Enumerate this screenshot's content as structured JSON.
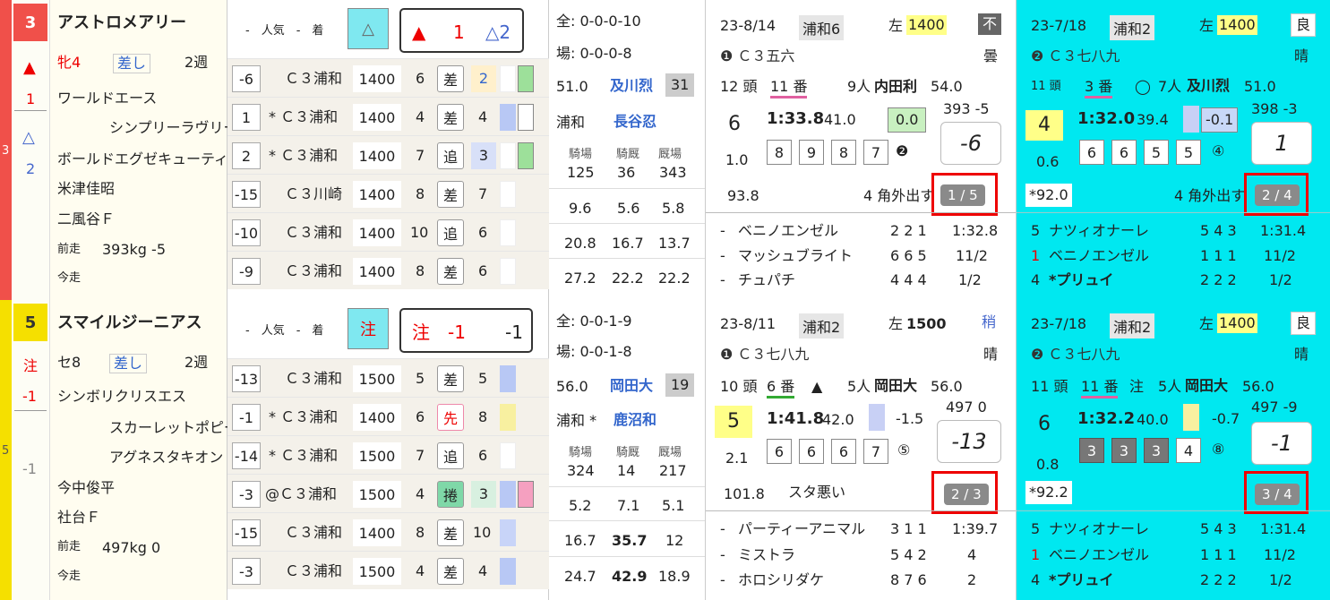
{
  "entries": [
    {
      "gate": "3",
      "gate_color": "#f0504a",
      "frame_num": "3",
      "mark_main": "▲",
      "mark_sub": "1",
      "mark_tri": "△",
      "mark_tri_num": "2",
      "name": "アストロメアリー",
      "sex_age": "牝4",
      "style": "差し",
      "interval": "2週",
      "sire": "ワールドエース",
      "dam": "シンプリーラヴリー",
      "damsire": "ボールドエグゼキューティブ",
      "jockey_trainer": "米津佳昭",
      "owner": "二風谷Ｆ",
      "prev_label": "前走",
      "weight": "393kg  -5",
      "now_label": "今走",
      "pop_label": "-　人気　-　着",
      "pop_mark": "△",
      "big_mark1": "▲",
      "big_mark1_num": "1",
      "big_mark2": "△2",
      "races": [
        {
          "diff": "-6",
          "cls": "Ｃ３浦和",
          "dist": "1400",
          "field": "6",
          "run": "差",
          "pos": "2"
        },
        {
          "diff": "1",
          "cls": "* Ｃ３浦和",
          "dist": "1400",
          "field": "4",
          "run": "差",
          "pos": "4"
        },
        {
          "diff": "2",
          "cls": "* Ｃ３浦和",
          "dist": "1400",
          "field": "7",
          "run": "追",
          "pos": "3"
        },
        {
          "diff": "-15",
          "cls": "Ｃ３川崎",
          "dist": "1400",
          "field": "8",
          "run": "差",
          "pos": "7"
        },
        {
          "diff": "-10",
          "cls": "Ｃ３浦和",
          "dist": "1400",
          "field": "10",
          "run": "追",
          "pos": "6"
        },
        {
          "diff": "-9",
          "cls": "Ｃ３浦和",
          "dist": "1400",
          "field": "8",
          "run": "差",
          "pos": "6"
        }
      ],
      "rec_all": "全: 0-0-0-10",
      "rec_course": "場: 0-0-0-8",
      "weight_carry": "51.0",
      "jockey": "及川烈",
      "jockey_num": "31",
      "trainer_loc": "浦和",
      "trainer": "長谷忍",
      "stat_h1": "騎場",
      "stat_h2": "騎厩",
      "stat_h3": "厩場",
      "stat_r1": [
        "125",
        "36",
        "343"
      ],
      "stat_r2": [
        "9.6",
        "5.6",
        "5.8"
      ],
      "stat_r3": [
        "20.8",
        "16.7",
        "13.7"
      ],
      "stat_r4": [
        "27.2",
        "22.2",
        "22.2"
      ],
      "p1": {
        "date": "23-8/14",
        "course": "浦和6",
        "dist_label": "左",
        "dist": "1400",
        "track": "不",
        "cls": "❶ Ｃ３五六",
        "weather": "曇",
        "heads": "12 頭",
        "no": "11 番",
        "mk": "",
        "pop": "9人",
        "jockey": "内田利",
        "wt": "54.0",
        "place": "6",
        "time": "1:33.8",
        "f3": "41.0",
        "odds": "1.0",
        "diff": "0.0",
        "bw": "393 -5",
        "corners": [
          "8",
          "9",
          "8",
          "7"
        ],
        "circ": "❷",
        "score": "-6",
        "rating": "93.8",
        "comment": "4 角外出す",
        "rank": "1 / 5",
        "res": [
          [
            "ベニノエンゼル",
            "2 2 1",
            "1:32.8"
          ],
          [
            "マッシュブライト",
            "6 6 5",
            "11/2"
          ],
          [
            "チュパチ",
            "4 4 4",
            "1/2"
          ]
        ]
      },
      "p2": {
        "date": "23-7/18",
        "course": "浦和2",
        "dist_label": "左",
        "dist": "1400",
        "track": "良",
        "cls": "❷ Ｃ３七八九",
        "weather": "晴",
        "heads": "11 頭",
        "no": "3 番",
        "mk": "◯",
        "pop": "7人",
        "jockey": "及川烈",
        "wt": "51.0",
        "place": "4",
        "time": "1:32.0",
        "f3": "39.4",
        "odds": "0.6",
        "diff": "-0.1",
        "bw": "398 -3",
        "corners": [
          "6",
          "6",
          "5",
          "5"
        ],
        "circ": "④",
        "score": "1",
        "rating": "*92.0",
        "comment": "4 角外出す",
        "rank": "2 / 4",
        "res": [
          [
            "5",
            "ナツィオナーレ",
            "5 4 3",
            "1:31.4"
          ],
          [
            "1",
            "ベニノエンゼル",
            "1 1 1",
            "11/2"
          ],
          [
            "4",
            "*プリュイ",
            "2 2 2",
            "1/2"
          ]
        ]
      }
    },
    {
      "gate": "5",
      "gate_color": "#f5e000",
      "frame_num": "5",
      "mark_main": "注",
      "mark_sub": "-1",
      "mark_tri": "",
      "mark_tri_num": "-1",
      "name": "スマイルジーニアス",
      "sex_age": "セ8",
      "style": "差し",
      "interval": "2週",
      "sire": "シンボリクリスエス",
      "dam": "スカーレットポピー",
      "damsire": "アグネスタキオン",
      "jockey_trainer": "今中俊平",
      "owner": "社台Ｆ",
      "prev_label": "前走",
      "weight": "497kg  0",
      "now_label": "今走",
      "pop_label": "-　人気　-　着",
      "pop_mark": "注",
      "big_mark1": "注",
      "big_mark1_num": "-1",
      "big_mark2": "-1",
      "races": [
        {
          "diff": "-13",
          "cls": "Ｃ３浦和",
          "dist": "1500",
          "field": "5",
          "run": "差",
          "pos": "5"
        },
        {
          "diff": "-1",
          "cls": "* Ｃ３浦和",
          "dist": "1400",
          "field": "6",
          "run": "先",
          "pos": "8"
        },
        {
          "diff": "-14",
          "cls": "* Ｃ３浦和",
          "dist": "1500",
          "field": "7",
          "run": "追",
          "pos": "6"
        },
        {
          "diff": "-3",
          "cls": "@Ｃ３浦和",
          "dist": "1500",
          "field": "4",
          "run": "捲",
          "pos": "3"
        },
        {
          "diff": "-15",
          "cls": "Ｃ３浦和",
          "dist": "1400",
          "field": "8",
          "run": "差",
          "pos": "10"
        },
        {
          "diff": "-3",
          "cls": "Ｃ３浦和",
          "dist": "1500",
          "field": "4",
          "run": "差",
          "pos": "4"
        }
      ],
      "rec_all": "全: 0-0-1-9",
      "rec_course": "場: 0-0-1-8",
      "weight_carry": "56.0",
      "jockey": "岡田大",
      "jockey_num": "19",
      "trainer_loc": "浦和 *",
      "trainer": "鹿沼和",
      "stat_h1": "騎場",
      "stat_h2": "騎厩",
      "stat_h3": "厩場",
      "stat_r1": [
        "324",
        "14",
        "217"
      ],
      "stat_r2": [
        "5.2",
        "7.1",
        "5.1"
      ],
      "stat_r3": [
        "16.7",
        "35.7",
        "12"
      ],
      "stat_r4": [
        "24.7",
        "42.9",
        "18.9"
      ],
      "p1": {
        "date": "23-8/11",
        "course": "浦和2",
        "dist_label": "左",
        "dist": "1500",
        "track": "稍",
        "cls": "❶ Ｃ３七八九",
        "weather": "晴",
        "heads": "10 頭",
        "no": "6 番",
        "mk": "▲",
        "pop": "5人",
        "jockey": "岡田大",
        "wt": "56.0",
        "place": "5",
        "time": "1:41.8",
        "f3": "42.0",
        "odds": "2.1",
        "diff": "-1.5",
        "bw": "497 0",
        "corners": [
          "6",
          "6",
          "6",
          "7"
        ],
        "circ": "⑤",
        "score": "-13",
        "rating": "101.8",
        "comment": "スタ悪い",
        "rank": "2 / 3",
        "res": [
          [
            "パーティーアニマル",
            "3 1 1",
            "1:39.7"
          ],
          [
            "ミストラ",
            "5 4 2",
            "4"
          ],
          [
            "ホロシリダケ",
            "8 7 6",
            "2"
          ]
        ]
      },
      "p2": {
        "date": "23-7/18",
        "course": "浦和2",
        "dist_label": "左",
        "dist": "1400",
        "track": "良",
        "cls": "❷ Ｃ３七八九",
        "weather": "晴",
        "heads": "11 頭",
        "no": "11 番",
        "mk": "注",
        "pop": "5人",
        "jockey": "岡田大",
        "wt": "56.0",
        "place": "6",
        "time": "1:32.2",
        "f3": "40.0",
        "odds": "0.8",
        "diff": "-0.7",
        "bw": "497 -9",
        "corners": [
          "3",
          "3",
          "3",
          "4"
        ],
        "circ": "⑧",
        "score": "-1",
        "rating": "*92.2",
        "comment": "",
        "rank": "3 / 4",
        "res": [
          [
            "5",
            "ナツィオナーレ",
            "5 4 3",
            "1:31.4"
          ],
          [
            "1",
            "ベニノエンゼル",
            "1 1 1",
            "11/2"
          ],
          [
            "4",
            "*プリュイ",
            "2 2 2",
            "1/2"
          ]
        ]
      }
    }
  ]
}
